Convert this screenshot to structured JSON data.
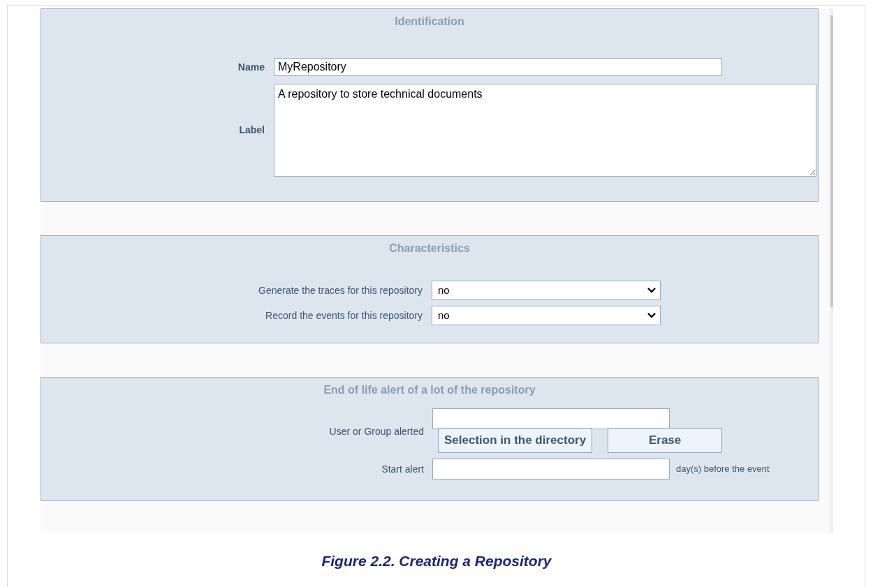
{
  "sections": [
    {
      "title": "Identification",
      "kind": "identification",
      "name": {
        "label": "Name",
        "value": "MyRepository"
      },
      "description": {
        "label": "Label",
        "value": "A repository to store technical documents"
      }
    },
    {
      "title": "Characteristics",
      "kind": "characteristics",
      "selects": [
        {
          "label": "Generate the traces for this repository",
          "value": "no"
        },
        {
          "label": "Record the events for this repository",
          "value": "no"
        }
      ]
    },
    {
      "title": "End of life alert of a lot of the repository",
      "kind": "alert",
      "user": {
        "label": "User or Group alerted",
        "buttons": [
          "Selection in the directory",
          "Erase"
        ]
      },
      "start": {
        "label": "Start alert",
        "suffix": "day(s) before the event"
      }
    }
  ],
  "caption": "Figure 2.2. Creating a Repository"
}
